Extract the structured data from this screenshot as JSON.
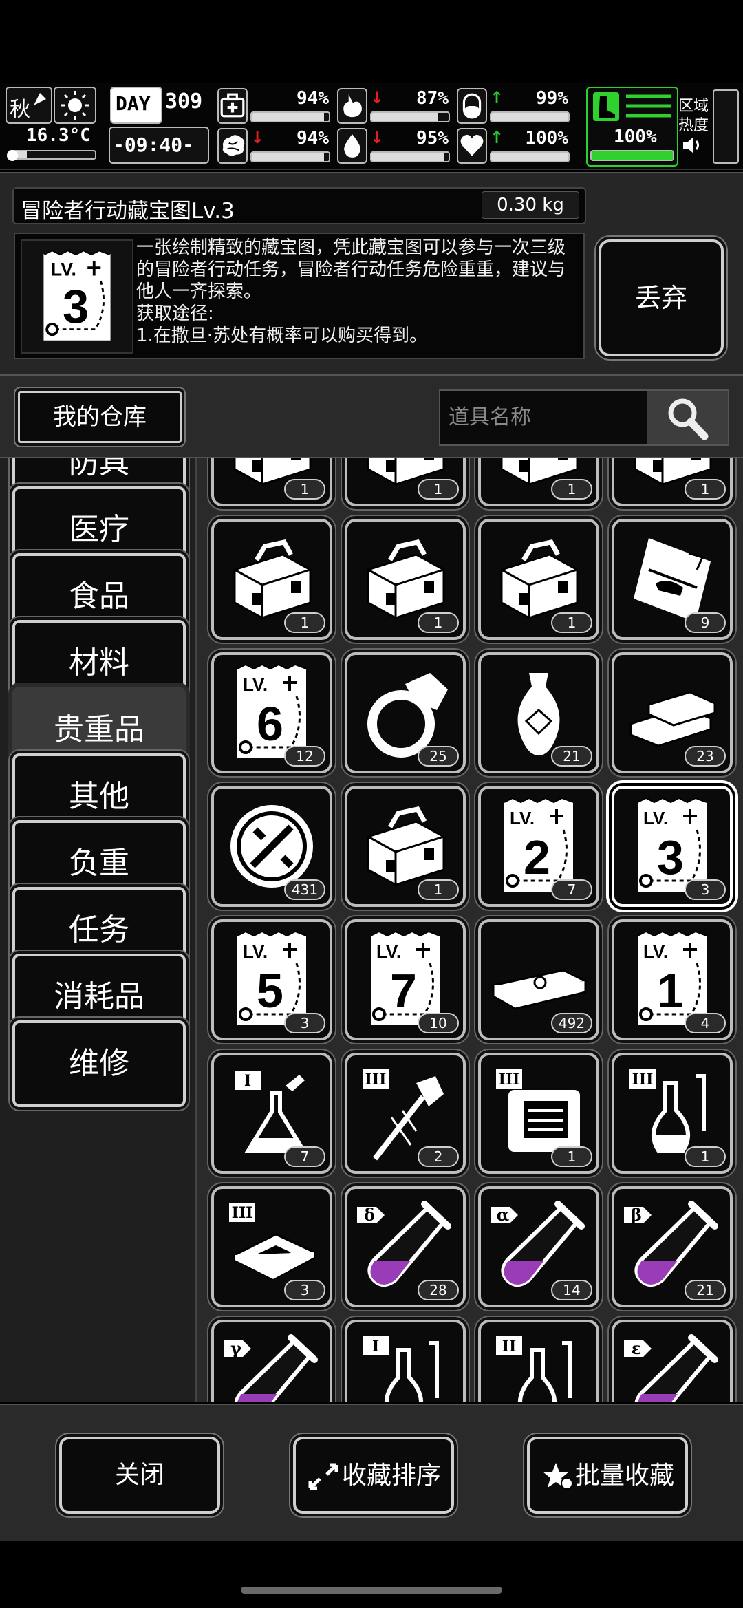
{
  "status": {
    "season": "秋",
    "day_label": "DAY",
    "day": "309",
    "temperature": "16.3°C",
    "clock": "-09:40-",
    "stats": [
      {
        "key": "health",
        "icon": "medkit-icon",
        "value": "94%",
        "trend": "none",
        "level": 0.94
      },
      {
        "key": "hunger",
        "icon": "stomach-icon",
        "value": "87%",
        "trend": "down",
        "level": 0.87
      },
      {
        "key": "stamina",
        "icon": "pill-icon",
        "value": "99%",
        "trend": "up",
        "level": 0.99
      },
      {
        "key": "mind",
        "icon": "brain-icon",
        "value": "94%",
        "trend": "down",
        "level": 0.94
      },
      {
        "key": "thirst",
        "icon": "water-drop-icon",
        "value": "95%",
        "trend": "down",
        "level": 0.95
      },
      {
        "key": "mood",
        "icon": "heart-icon",
        "value": "100%",
        "trend": "up",
        "level": 1.0
      }
    ],
    "boots_value": "100%",
    "boots_level": 1.0,
    "zone_label_1": "区域",
    "zone_label_2": "热度"
  },
  "detail": {
    "title": "冒险者行动藏宝图Lv.3",
    "weight": "0.30 kg",
    "icon_level": "3",
    "icon_lv_text": "LV.",
    "description": "一张绘制精致的藏宝图，凭此藏宝图可以参与一次三级的冒险者行动任务，冒险者行动任务危险重重，建议与他人一齐探索。\n获取途径:\n1.在撒旦·苏处有概率可以购买得到。",
    "discard_label": "丢弃"
  },
  "warehouse": {
    "my_warehouse_label": "我的仓库",
    "search_placeholder": "道具名称"
  },
  "categories": [
    {
      "label": "防具",
      "active": false
    },
    {
      "label": "医疗",
      "active": false
    },
    {
      "label": "食品",
      "active": false
    },
    {
      "label": "材料",
      "active": false
    },
    {
      "label": "贵重品",
      "active": true
    },
    {
      "label": "其他",
      "active": false
    },
    {
      "label": "负重",
      "active": false
    },
    {
      "label": "任务",
      "active": false
    },
    {
      "label": "消耗品",
      "active": false
    },
    {
      "label": "维修",
      "active": false
    }
  ],
  "inventory": [
    {
      "icon": "toolbox-icon",
      "count": "1"
    },
    {
      "icon": "toolbox-icon",
      "count": "1"
    },
    {
      "icon": "toolbox-icon",
      "count": "1"
    },
    {
      "icon": "toolbox-icon",
      "count": "1"
    },
    {
      "icon": "toolbox-icon",
      "count": "1"
    },
    {
      "icon": "toolbox-icon",
      "count": "1"
    },
    {
      "icon": "toolbox-icon",
      "count": "1"
    },
    {
      "icon": "helicopter-ticket-icon",
      "count": "9"
    },
    {
      "icon": "treasure-map-icon",
      "level": "6",
      "count": "12"
    },
    {
      "icon": "ring-icon",
      "count": "25"
    },
    {
      "icon": "vase-icon",
      "count": "21"
    },
    {
      "icon": "gold-bars-icon",
      "count": "23"
    },
    {
      "icon": "coin-badge-icon",
      "count": "431"
    },
    {
      "icon": "toolbox-icon",
      "count": "1"
    },
    {
      "icon": "treasure-map-icon",
      "level": "2",
      "count": "7"
    },
    {
      "icon": "treasure-map-icon",
      "level": "3",
      "count": "3",
      "selected": true
    },
    {
      "icon": "treasure-map-icon",
      "level": "5",
      "count": "3"
    },
    {
      "icon": "treasure-map-icon",
      "level": "7",
      "count": "10"
    },
    {
      "icon": "cash-stack-icon",
      "count": "492"
    },
    {
      "icon": "treasure-map-icon",
      "level": "1",
      "count": "4"
    },
    {
      "icon": "flask-icon",
      "tier": "I",
      "count": "7"
    },
    {
      "icon": "syringe-gem-icon",
      "tier": "III",
      "count": "2"
    },
    {
      "icon": "machine-icon",
      "tier": "III",
      "count": "1"
    },
    {
      "icon": "lab-glassware-icon",
      "tier": "III",
      "count": "1"
    },
    {
      "icon": "chip-icon",
      "tier": "III",
      "count": "3"
    },
    {
      "icon": "test-tube-icon",
      "tier": "δ",
      "count": "28"
    },
    {
      "icon": "test-tube-icon",
      "tier": "α",
      "count": "14"
    },
    {
      "icon": "test-tube-icon",
      "tier": "β",
      "count": "21"
    },
    {
      "icon": "test-tube-icon",
      "tier": "γ",
      "count": ""
    },
    {
      "icon": "lab-glassware-icon",
      "tier": "I",
      "count": ""
    },
    {
      "icon": "lab-glassware-icon",
      "tier": "II",
      "count": ""
    },
    {
      "icon": "test-tube-icon",
      "tier": "ε",
      "count": ""
    }
  ],
  "bottom": {
    "close_label": "关闭",
    "sort_label": "收藏排序",
    "batch_label": "批量收藏"
  }
}
